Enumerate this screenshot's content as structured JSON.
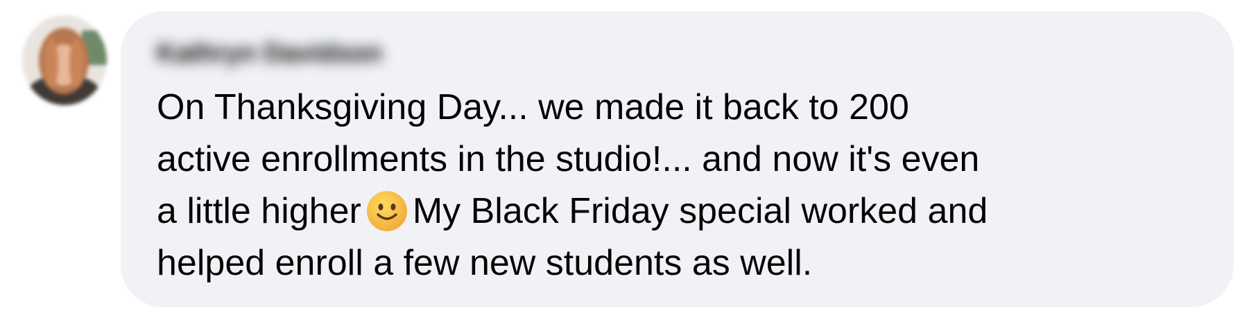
{
  "comment": {
    "author_name": "Kathryn Davidson",
    "text_line_1": "On Thanksgiving Day... we made it back to 200",
    "text_line_2": "active enrollments in the studio!... and now it's even",
    "text_line_3_before_emoji": "a little higher",
    "emoji": "slightly-smiling-face-icon",
    "text_line_3_after_emoji": "My Black Friday special worked and",
    "text_line_4": "helped enroll a few new students as well."
  },
  "colors": {
    "bubble_background": "#f0f2f5",
    "text": "#050505",
    "emoji_face": "#f7c33c"
  }
}
